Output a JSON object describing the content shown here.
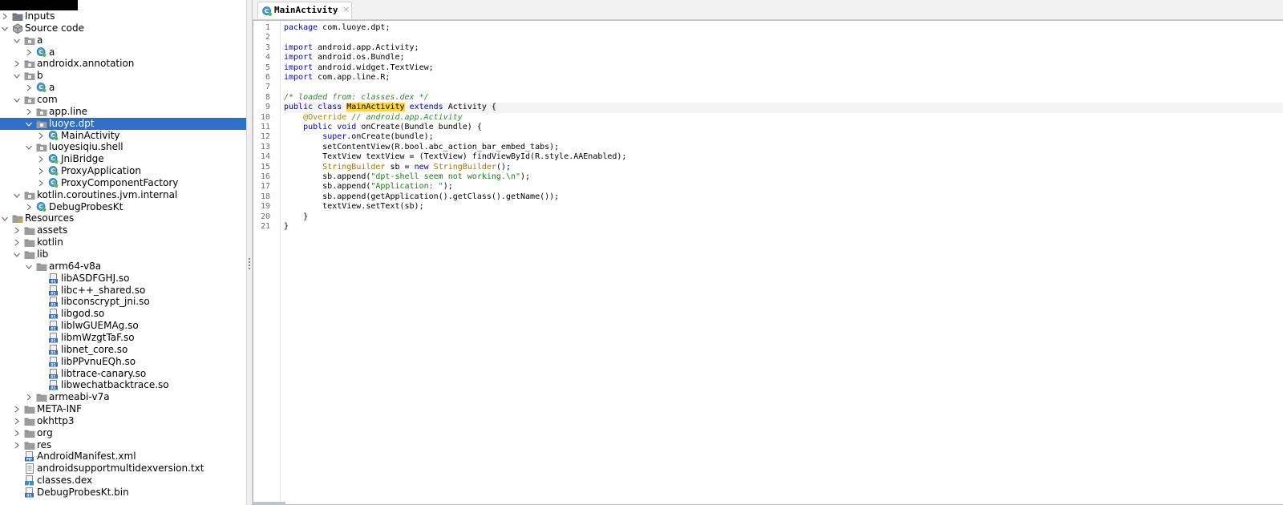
{
  "tree": [
    {
      "label": "Inputs",
      "depth": 0,
      "arrow": "right",
      "icon": "inputs-icon"
    },
    {
      "label": "Source code",
      "depth": 0,
      "arrow": "down",
      "icon": "source-code-icon"
    },
    {
      "label": "a",
      "depth": 1,
      "arrow": "down",
      "icon": "package-icon"
    },
    {
      "label": "a",
      "depth": 2,
      "arrow": "right",
      "icon": "class-icon"
    },
    {
      "label": "androidx.annotation",
      "depth": 1,
      "arrow": "right",
      "icon": "package-icon"
    },
    {
      "label": "b",
      "depth": 1,
      "arrow": "down",
      "icon": "package-icon"
    },
    {
      "label": "a",
      "depth": 2,
      "arrow": "right",
      "icon": "class-icon"
    },
    {
      "label": "com",
      "depth": 1,
      "arrow": "down",
      "icon": "package-icon"
    },
    {
      "label": "app.line",
      "depth": 2,
      "arrow": "right",
      "icon": "package-icon"
    },
    {
      "label": "luoye.dpt",
      "depth": 2,
      "arrow": "down",
      "icon": "package-icon",
      "selected": true
    },
    {
      "label": "MainActivity",
      "depth": 3,
      "arrow": "right",
      "icon": "class-icon"
    },
    {
      "label": "luoyesiqiu.shell",
      "depth": 2,
      "arrow": "down",
      "icon": "package-icon"
    },
    {
      "label": "JniBridge",
      "depth": 3,
      "arrow": "right",
      "icon": "class-icon"
    },
    {
      "label": "ProxyApplication",
      "depth": 3,
      "arrow": "right",
      "icon": "class-icon"
    },
    {
      "label": "ProxyComponentFactory",
      "depth": 3,
      "arrow": "right",
      "icon": "class-icon"
    },
    {
      "label": "kotlin.coroutines.jvm.internal",
      "depth": 1,
      "arrow": "down",
      "icon": "package-icon"
    },
    {
      "label": "DebugProbesKt",
      "depth": 2,
      "arrow": "right",
      "icon": "class-icon"
    },
    {
      "label": "Resources",
      "depth": 0,
      "arrow": "down",
      "icon": "resources-icon"
    },
    {
      "label": "assets",
      "depth": 1,
      "arrow": "right",
      "icon": "folder-icon"
    },
    {
      "label": "kotlin",
      "depth": 1,
      "arrow": "right",
      "icon": "folder-icon"
    },
    {
      "label": "lib",
      "depth": 1,
      "arrow": "down",
      "icon": "folder-icon"
    },
    {
      "label": "arm64-v8a",
      "depth": 2,
      "arrow": "down",
      "icon": "folder-icon"
    },
    {
      "label": "libASDFGHJ.so",
      "depth": 3,
      "arrow": "none",
      "icon": "binary-file-icon"
    },
    {
      "label": "libc++_shared.so",
      "depth": 3,
      "arrow": "none",
      "icon": "binary-file-icon"
    },
    {
      "label": "libconscrypt_jni.so",
      "depth": 3,
      "arrow": "none",
      "icon": "binary-file-icon"
    },
    {
      "label": "libgod.so",
      "depth": 3,
      "arrow": "none",
      "icon": "binary-file-icon"
    },
    {
      "label": "liblwGUEMAg.so",
      "depth": 3,
      "arrow": "none",
      "icon": "binary-file-icon"
    },
    {
      "label": "libmWzgtTaF.so",
      "depth": 3,
      "arrow": "none",
      "icon": "binary-file-icon"
    },
    {
      "label": "libnet_core.so",
      "depth": 3,
      "arrow": "none",
      "icon": "binary-file-icon"
    },
    {
      "label": "libPPvnuEQh.so",
      "depth": 3,
      "arrow": "none",
      "icon": "binary-file-icon"
    },
    {
      "label": "libtrace-canary.so",
      "depth": 3,
      "arrow": "none",
      "icon": "binary-file-icon"
    },
    {
      "label": "libwechatbacktrace.so",
      "depth": 3,
      "arrow": "none",
      "icon": "binary-file-icon"
    },
    {
      "label": "armeabi-v7a",
      "depth": 2,
      "arrow": "right",
      "icon": "folder-icon"
    },
    {
      "label": "META-INF",
      "depth": 1,
      "arrow": "right",
      "icon": "folder-icon"
    },
    {
      "label": "okhttp3",
      "depth": 1,
      "arrow": "right",
      "icon": "folder-icon"
    },
    {
      "label": "org",
      "depth": 1,
      "arrow": "right",
      "icon": "folder-icon"
    },
    {
      "label": "res",
      "depth": 1,
      "arrow": "right",
      "icon": "folder-icon"
    },
    {
      "label": "AndroidManifest.xml",
      "depth": 1,
      "arrow": "none",
      "icon": "manifest-file-icon"
    },
    {
      "label": "androidsupportmultidexversion.txt",
      "depth": 1,
      "arrow": "none",
      "icon": "text-file-icon"
    },
    {
      "label": "classes.dex",
      "depth": 1,
      "arrow": "none",
      "icon": "dex-file-icon"
    },
    {
      "label": "DebugProbesKt.bin",
      "depth": 1,
      "arrow": "none",
      "icon": "binary-file-icon"
    }
  ],
  "editor": {
    "tab_label": "MainActivity",
    "tab_close": "×",
    "current_line": 9,
    "lines": [
      [
        {
          "t": "package",
          "c": "kw"
        },
        {
          "t": " com.luoye.dpt;"
        }
      ],
      [],
      [
        {
          "t": "import",
          "c": "kw"
        },
        {
          "t": " android.app.Activity;"
        }
      ],
      [
        {
          "t": "import",
          "c": "kw"
        },
        {
          "t": " android.os.Bundle;"
        }
      ],
      [
        {
          "t": "import",
          "c": "kw"
        },
        {
          "t": " android.widget.TextView;"
        }
      ],
      [
        {
          "t": "import",
          "c": "kw"
        },
        {
          "t": " com.app.line.R;"
        }
      ],
      [],
      [
        {
          "t": "/* loaded from: classes.dex */",
          "c": "comment"
        }
      ],
      [
        {
          "t": "public class",
          "c": "kw"
        },
        {
          "t": " "
        },
        {
          "t": "MainActivity",
          "c": "highlight"
        },
        {
          "t": " "
        },
        {
          "t": "extends",
          "c": "kw"
        },
        {
          "t": " Activity {"
        }
      ],
      [
        {
          "t": "    "
        },
        {
          "t": "@Override",
          "c": "annotation"
        },
        {
          "t": " "
        },
        {
          "t": "// android.app.Activity",
          "c": "comment"
        }
      ],
      [
        {
          "t": "    "
        },
        {
          "t": "public void",
          "c": "kw"
        },
        {
          "t": " onCreate(Bundle bundle) {"
        }
      ],
      [
        {
          "t": "        "
        },
        {
          "t": "super",
          "c": "kw"
        },
        {
          "t": ".onCreate(bundle);"
        }
      ],
      [
        {
          "t": "        setContentView(R.bool.abc_action_bar_embed_tabs);"
        }
      ],
      [
        {
          "t": "        TextView textView = (TextView) findViewById(R.style.AAEnabled);"
        }
      ],
      [
        {
          "t": "        "
        },
        {
          "t": "StringBuilder",
          "c": "type"
        },
        {
          "t": " sb = "
        },
        {
          "t": "new",
          "c": "kw"
        },
        {
          "t": " "
        },
        {
          "t": "StringBuilder",
          "c": "type"
        },
        {
          "t": "();"
        }
      ],
      [
        {
          "t": "        sb.append("
        },
        {
          "t": "\"dpt-shell seem not working.\\n\"",
          "c": "string"
        },
        {
          "t": ");"
        }
      ],
      [
        {
          "t": "        sb.append("
        },
        {
          "t": "\"Application: \"",
          "c": "string"
        },
        {
          "t": ");"
        }
      ],
      [
        {
          "t": "        sb.append(getApplication().getClass().getName());"
        }
      ],
      [
        {
          "t": "        textView.setText(sb);"
        }
      ],
      [
        {
          "t": "    }"
        }
      ],
      [
        {
          "t": "}"
        }
      ]
    ]
  }
}
